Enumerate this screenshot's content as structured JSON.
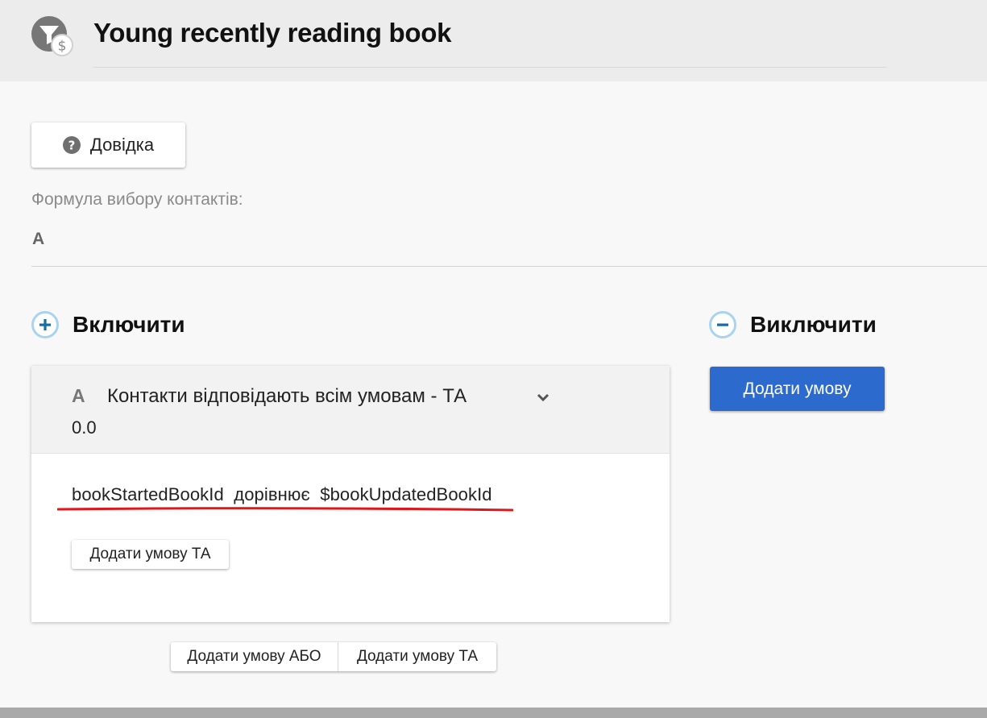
{
  "header": {
    "title": "Young recently reading book",
    "icon": "segment-funnel-dollar-icon"
  },
  "help": {
    "label": "Довідка",
    "icon": "question-circle-icon"
  },
  "formula": {
    "label": "Формула вибору контактів:",
    "value": "A"
  },
  "include": {
    "heading": "Включити",
    "icon": "plus-circle-icon",
    "group": {
      "letter": "A",
      "title": "Контакти відповідають всім умовам - ТА",
      "score": "0.0",
      "condition": "bookStartedBookId  дорівнює  $bookUpdatedBookId",
      "add_and_label": "Додати умову ТА"
    },
    "add_or_label": "Додати умову АБО",
    "add_and_label": "Додати умову ТА"
  },
  "exclude": {
    "heading": "Виключити",
    "icon": "minus-circle-icon",
    "add_condition_label": "Додати умову"
  },
  "colors": {
    "primary": "#2c6bcd",
    "circle_border": "#a9d3ee",
    "circle_glyph": "#1a6aa3",
    "underline": "#e0161b"
  }
}
